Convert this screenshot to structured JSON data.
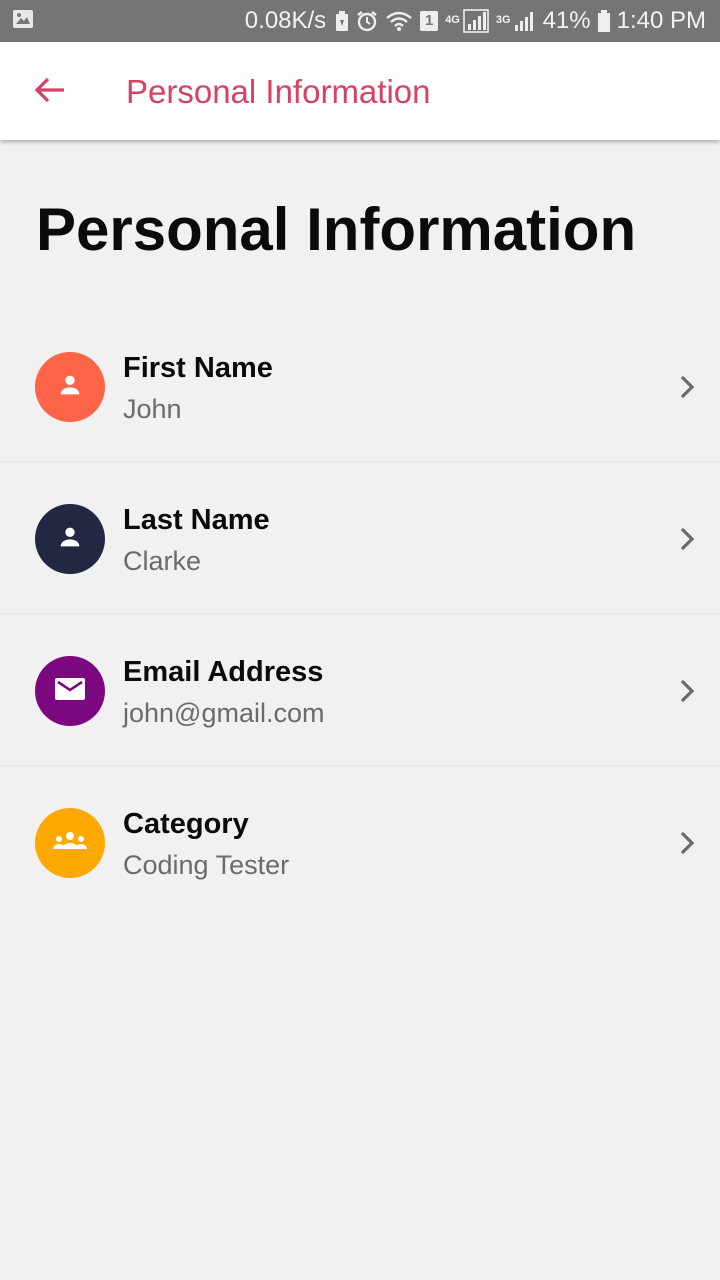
{
  "status_bar": {
    "net_speed": "0.08K/s",
    "notification_badge": "1",
    "network_4g": "4G",
    "network_3g": "3G",
    "battery": "41%",
    "time": "1:40 PM"
  },
  "app_bar": {
    "title": "Personal Information",
    "back_icon": "arrow-left-icon",
    "accent_color": "#d64263"
  },
  "page": {
    "heading": "Personal Information"
  },
  "info_items": [
    {
      "label": "First Name",
      "value": "John",
      "icon": "person-icon",
      "color": "#fe6447"
    },
    {
      "label": "Last Name",
      "value": "Clarke",
      "icon": "person-icon",
      "color": "#222841"
    },
    {
      "label": "Email Address",
      "value": "john@gmail.com",
      "icon": "email-icon",
      "color": "#7b087e"
    },
    {
      "label": "Category",
      "value": "Coding Tester",
      "icon": "group-icon",
      "color": "#ffa800"
    }
  ]
}
